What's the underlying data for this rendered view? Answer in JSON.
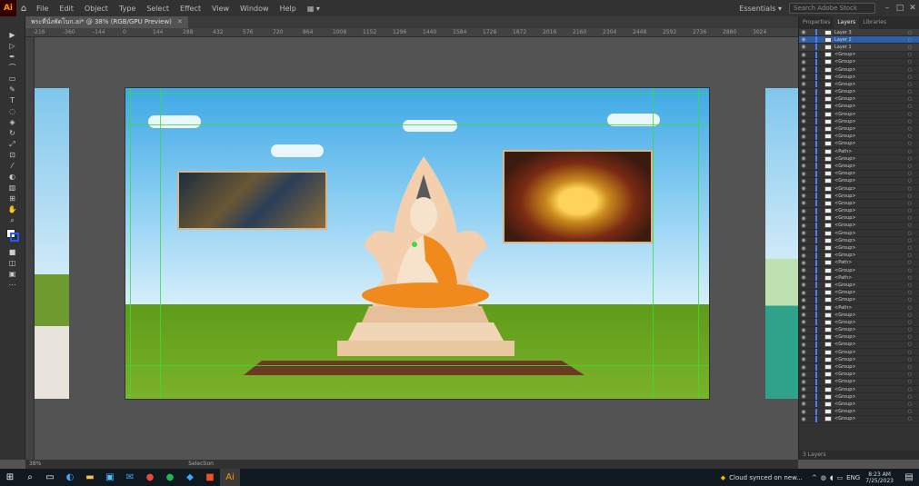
{
  "menubar": {
    "logo": "Ai",
    "items": [
      "File",
      "Edit",
      "Object",
      "Type",
      "Select",
      "Effect",
      "View",
      "Window",
      "Help"
    ],
    "workspace": "Essentials",
    "search_placeholder": "Search Adobe Stock"
  },
  "document": {
    "tab_label": "พระที่นั่งพัดโบก.ai* @ 38% (RGB/GPU Preview)",
    "zoom": "38%",
    "status_tool": "Selection"
  },
  "ruler": {
    "top_numbers": [
      "-216",
      "-360",
      "-144",
      "0",
      "144",
      "288",
      "432",
      "576",
      "720",
      "864",
      "1008",
      "1152",
      "1296",
      "1440",
      "1584",
      "1728",
      "1872",
      "2016",
      "2160",
      "2304",
      "2448",
      "2592",
      "2736",
      "2880",
      "3024"
    ]
  },
  "panel": {
    "tabs": [
      "Properties",
      "Layers",
      "Libraries"
    ],
    "active_tab": "Layers",
    "top_layers": [
      "Layer 3",
      "Layer 2",
      "Layer 1"
    ],
    "selected_layer": "Layer 2",
    "group_label": "<Group>",
    "rows": [
      "<Group>",
      "<Group>",
      "<Group>",
      "<Group>",
      "<Group>",
      "<Group>",
      "<Group>",
      "<Group>",
      "<Group>",
      "<Group>",
      "<Group>",
      "<Group>",
      "<Group>",
      "<Path>",
      "<Group>",
      "<Group>",
      "<Group>",
      "<Group>",
      "<Group>",
      "<Group>",
      "<Group>",
      "<Group>",
      "<Group>",
      "<Group>",
      "<Group>",
      "<Group>",
      "<Group>",
      "<Group>",
      "<Path>",
      "<Group>",
      "<Path>",
      "<Group>",
      "<Group>",
      "<Group>",
      "<Path>",
      "<Group>",
      "<Group>",
      "<Group>",
      "<Group>",
      "<Group>",
      "<Group>",
      "<Group>",
      "<Group>",
      "<Group>",
      "<Group>",
      "<Group>",
      "<Group>",
      "<Group>",
      "<Group>",
      "<Group>"
    ],
    "footer": "3 Layers"
  },
  "taskbar": {
    "notification": "Cloud synced on new...",
    "lang": "ENG",
    "time": "8:23 AM",
    "date": "7/25/2023"
  }
}
